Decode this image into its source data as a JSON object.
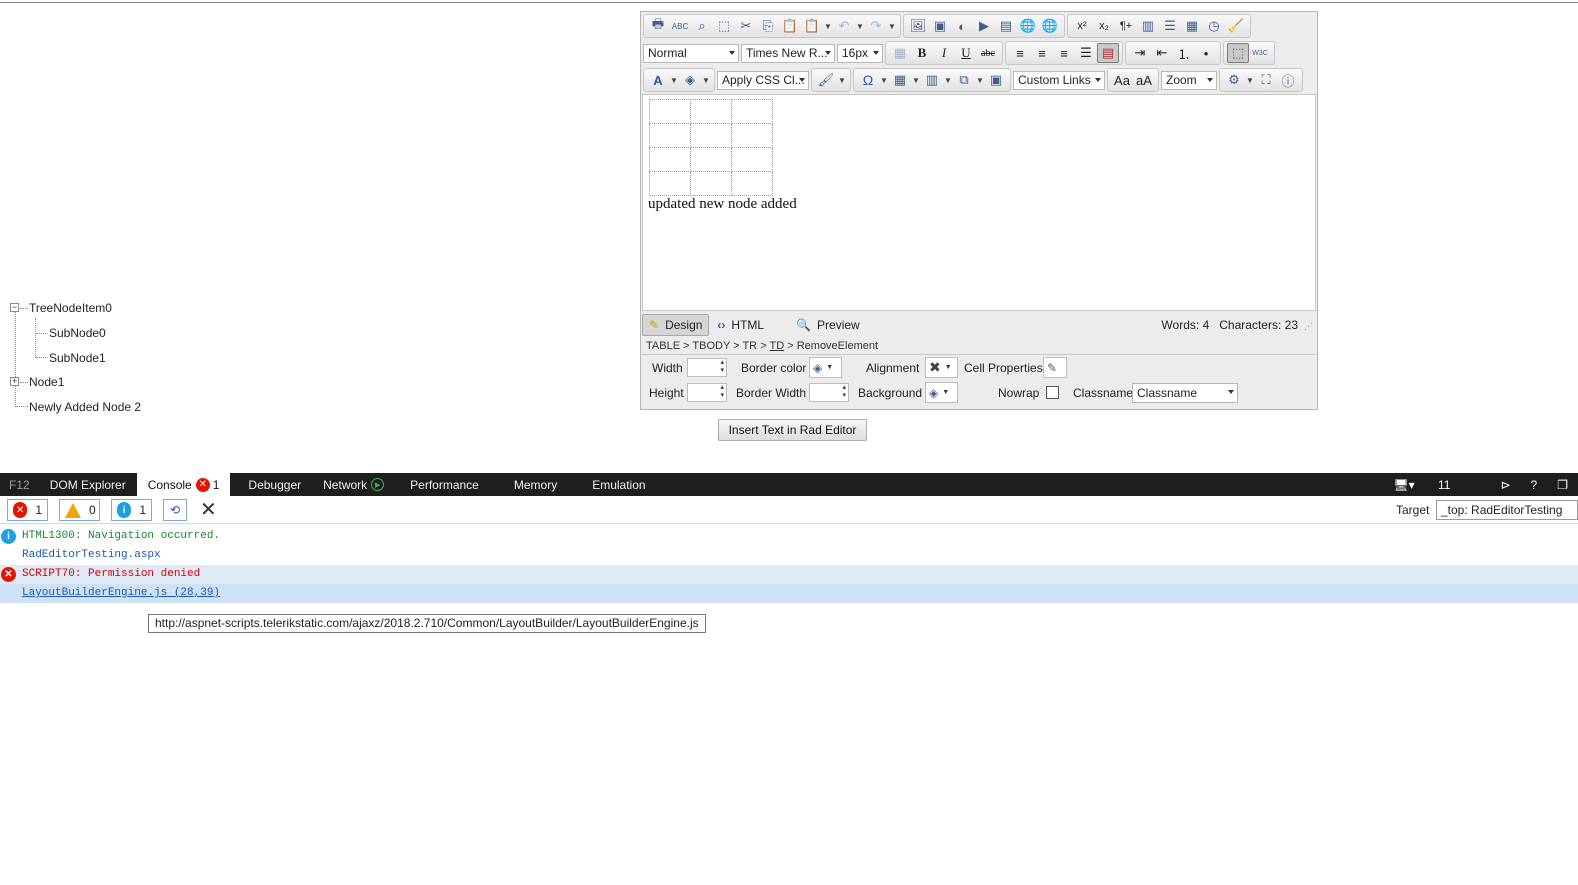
{
  "tree": {
    "nodes": [
      {
        "label": "TreeNodeItem0",
        "toggle": "−"
      },
      {
        "label": "SubNode0"
      },
      {
        "label": "SubNode1"
      },
      {
        "label": "Node1",
        "toggle": "+"
      },
      {
        "label": "Newly Added Node 2"
      }
    ]
  },
  "editor": {
    "toolbar": {
      "paragraph_style": "Normal",
      "font_name": "Times New R...",
      "font_size": "16px",
      "css_class": "Apply CSS Cl...",
      "custom_links": "Custom Links",
      "zoom": "Zoom",
      "omega": "Ω",
      "font_color": "A",
      "bold": "B",
      "italic": "I",
      "underline": "U",
      "strike": "abc",
      "superscript": "x²",
      "subscript": "x₂",
      "paragraph_mark": "¶+",
      "spell": "ABC",
      "w3c": "W3C"
    },
    "content_text": "updated new node added",
    "modes": {
      "design": "Design",
      "html": "HTML",
      "preview": "Preview"
    },
    "stats": {
      "words_label": "Words:",
      "words": "4",
      "chars_label": "Characters:",
      "chars": "23"
    },
    "dom_path": {
      "p1": "TABLE",
      "p2": "TBODY",
      "p3": "TR",
      "p4": "TD",
      "p5": "RemoveElement",
      "sep": ">"
    },
    "cell_props": {
      "width": "Width",
      "height": "Height",
      "border_color": "Border color",
      "border_width": "Border Width",
      "alignment": "Alignment",
      "background": "Background",
      "cell_properties": "Cell Properties",
      "nowrap": "Nowrap",
      "classname_label": "Classname",
      "classname_value": "Classname"
    }
  },
  "insert_button": "Insert Text in Rad Editor",
  "devtools": {
    "f12": "F12",
    "tabs": [
      "DOM Explorer",
      "Console",
      "Debugger",
      "Network",
      "Performance",
      "Memory",
      "Emulation"
    ],
    "console_errors": "1",
    "doc_mode": "11",
    "help": "?",
    "filters": {
      "errors": "1",
      "warnings": "0",
      "info": "1"
    },
    "target_label": "Target",
    "target_value": "_top: RadEditorTesting",
    "logs": [
      {
        "code": "HTML1300",
        "message": ": Navigation occurred.",
        "link": "RadEditorTesting.aspx"
      },
      {
        "code": "SCRIPT70",
        "message": ": Permission denied",
        "link": "LayoutBuilderEngine.js (28,39)"
      }
    ],
    "tooltip": "http://aspnet-scripts.telerikstatic.com/ajaxz/2018.2.710/Common/LayoutBuilder/LayoutBuilderEngine.js"
  }
}
